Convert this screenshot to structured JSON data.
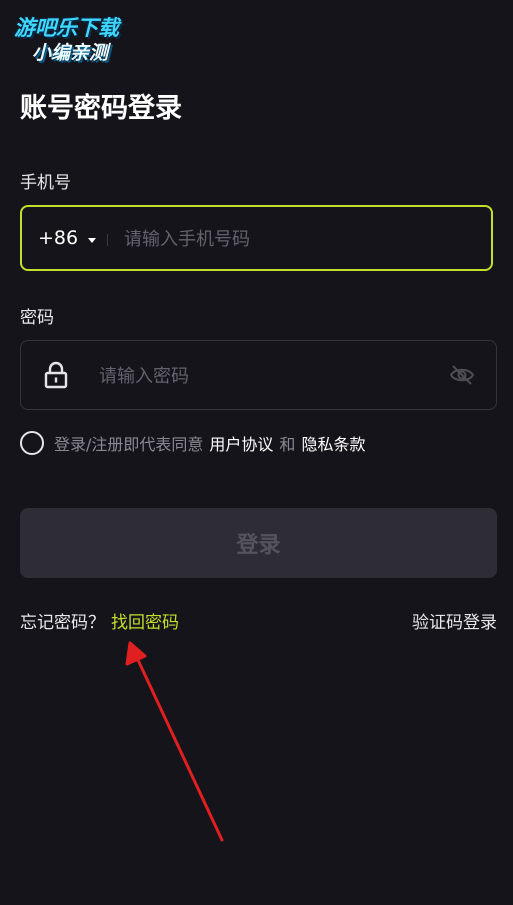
{
  "watermark": {
    "line1": "游吧乐下载",
    "line2": "小编亲测"
  },
  "page": {
    "title": "账号密码登录"
  },
  "phone": {
    "label": "手机号",
    "country_code": "+86",
    "placeholder": "请输入手机号码",
    "value": ""
  },
  "password": {
    "label": "密码",
    "placeholder": "请输入密码",
    "value": ""
  },
  "agreement": {
    "checked": false,
    "prefix": "登录/注册即代表同意",
    "user_agreement": "用户协议",
    "conjunction": "和",
    "privacy_policy": "隐私条款"
  },
  "login_button": {
    "label": "登录",
    "enabled": false
  },
  "footer": {
    "forgot_text": "忘记密码？",
    "recover_link": "找回密码",
    "sms_login": "验证码登录"
  },
  "icons": {
    "lock": "lock-icon",
    "visibility": "eye-off-icon",
    "dropdown": "caret-down-icon"
  },
  "colors": {
    "background": "#15141a",
    "accent": "#c4df2b",
    "button_disabled": "#2e2d35",
    "annotation_arrow": "#e02020"
  }
}
